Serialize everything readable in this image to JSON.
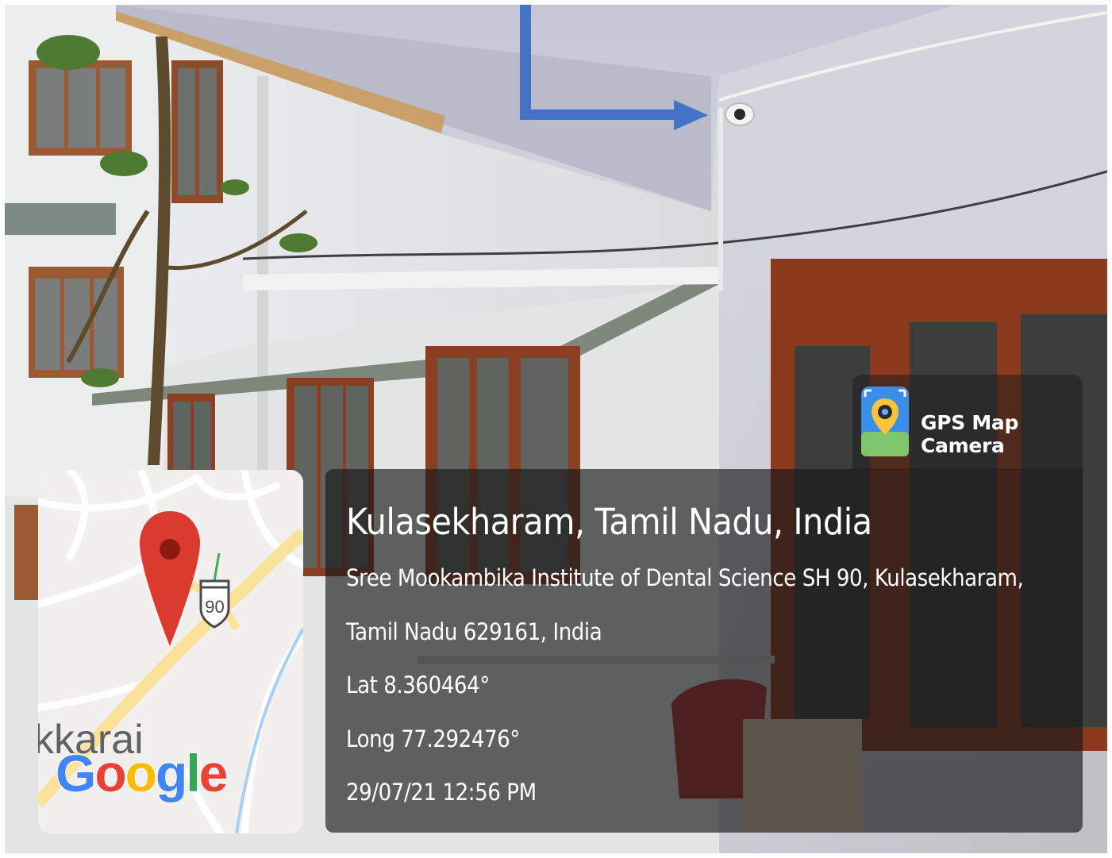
{
  "photo": {
    "description_icon": "surveillance-camera-icon"
  },
  "annotation": {
    "arrow_color": "#4472C4"
  },
  "gps_overlay": {
    "brand_label": "GPS Map Camera",
    "brand_icon": "gps-map-camera-app-icon",
    "location_title": "Kulasekharam, Tamil Nadu, India",
    "address_line1": "Sree Mookambika Institute of Dental Science SH 90, Kulasekharam,",
    "address_line2": "Tamil Nadu 629161, India",
    "latitude": "Lat 8.360464°",
    "longitude": "Long 77.292476°",
    "timestamp": "29/07/21 12:56 PM"
  },
  "map": {
    "route_shield": "90",
    "place_fragment": "kkarai",
    "logo_letters": [
      "G",
      "o",
      "o",
      "g",
      "l",
      "e"
    ],
    "pin_color": "#DB3A2E"
  }
}
